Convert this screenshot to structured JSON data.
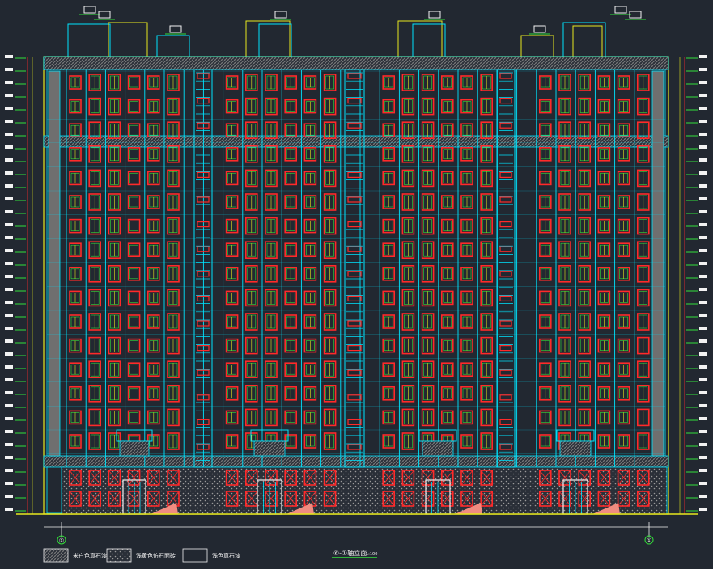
{
  "drawing": {
    "title": "⑥-①轴立面",
    "scale": "1:100",
    "grid_start": "①",
    "grid_end": "①",
    "floors_typical": 16,
    "floors_lower": 2
  },
  "legend": [
    {
      "label": "米白色真石漆",
      "swatch": "hatch-fine"
    },
    {
      "label": "浅黄色仿石面砖",
      "swatch": "hatch-coarse"
    },
    {
      "label": "浅色真石漆",
      "swatch": "plain"
    }
  ],
  "colors": {
    "background": "#222831",
    "cyan": "#00e5ff",
    "yellow": "#e8e81e",
    "green": "#33e03a",
    "red": "#ff2a2a",
    "white": "#f2f2f2",
    "salmon": "#f08c80",
    "gray": "#8d8d8d"
  }
}
